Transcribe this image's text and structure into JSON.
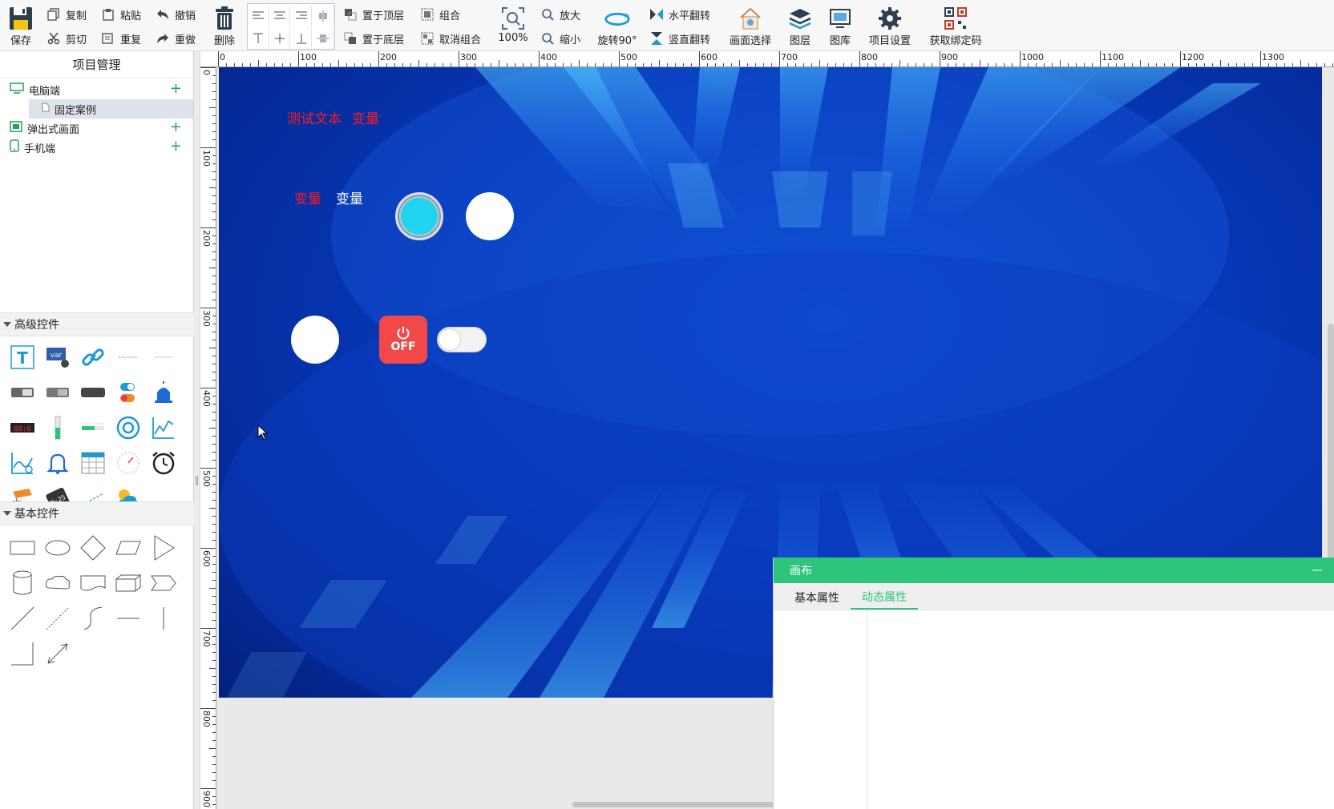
{
  "toolbar": {
    "save": "保存",
    "copy": "复制",
    "paste": "粘贴",
    "undo": "撤销",
    "cut": "剪切",
    "repeat": "重复",
    "redo": "重做",
    "delete": "删除",
    "bring_top": "置于顶层",
    "send_bottom": "置于底层",
    "group": "组合",
    "ungroup": "取消组合",
    "zoom_level": "100%",
    "zoom_in": "放大",
    "zoom_out": "缩小",
    "rotate": "旋转90°",
    "flip_h": "水平翻转",
    "flip_v": "竖直翻转",
    "screen_select": "画面选择",
    "layers": "图层",
    "gallery": "图库",
    "project_settings": "项目设置",
    "binding_code": "获取绑定码"
  },
  "left_panel": {
    "title": "项目管理",
    "tree": [
      {
        "label": "电脑端",
        "icon": "monitor-icon"
      },
      {
        "label": "固定案例",
        "icon": "page-icon",
        "selected": true
      },
      {
        "label": "弹出式画面",
        "icon": "popup-icon"
      },
      {
        "label": "手机端",
        "icon": "phone-icon"
      }
    ],
    "advanced_title": "高级控件",
    "basic_title": "基本控件"
  },
  "ruler": {
    "top_labels": [
      "0",
      "100",
      "200",
      "300",
      "400",
      "500",
      "600",
      "700",
      "800",
      "900",
      "1000",
      "1100",
      "1200",
      "1300"
    ],
    "left_labels": [
      "0",
      "100",
      "200",
      "300",
      "400",
      "500",
      "600",
      "700",
      "800",
      "900"
    ]
  },
  "canvas": {
    "text1": "测试文本",
    "text2": "变量",
    "text3": "变量",
    "text4": "变量",
    "power_label": "OFF",
    "colors": {
      "red": "#ff1a1a",
      "cyan": "#22d3f0",
      "power": "#f24848"
    }
  },
  "props": {
    "title": "画布",
    "tabs": [
      "基本属性",
      "动态属性"
    ],
    "active_tab": 1,
    "minimize": "—"
  }
}
